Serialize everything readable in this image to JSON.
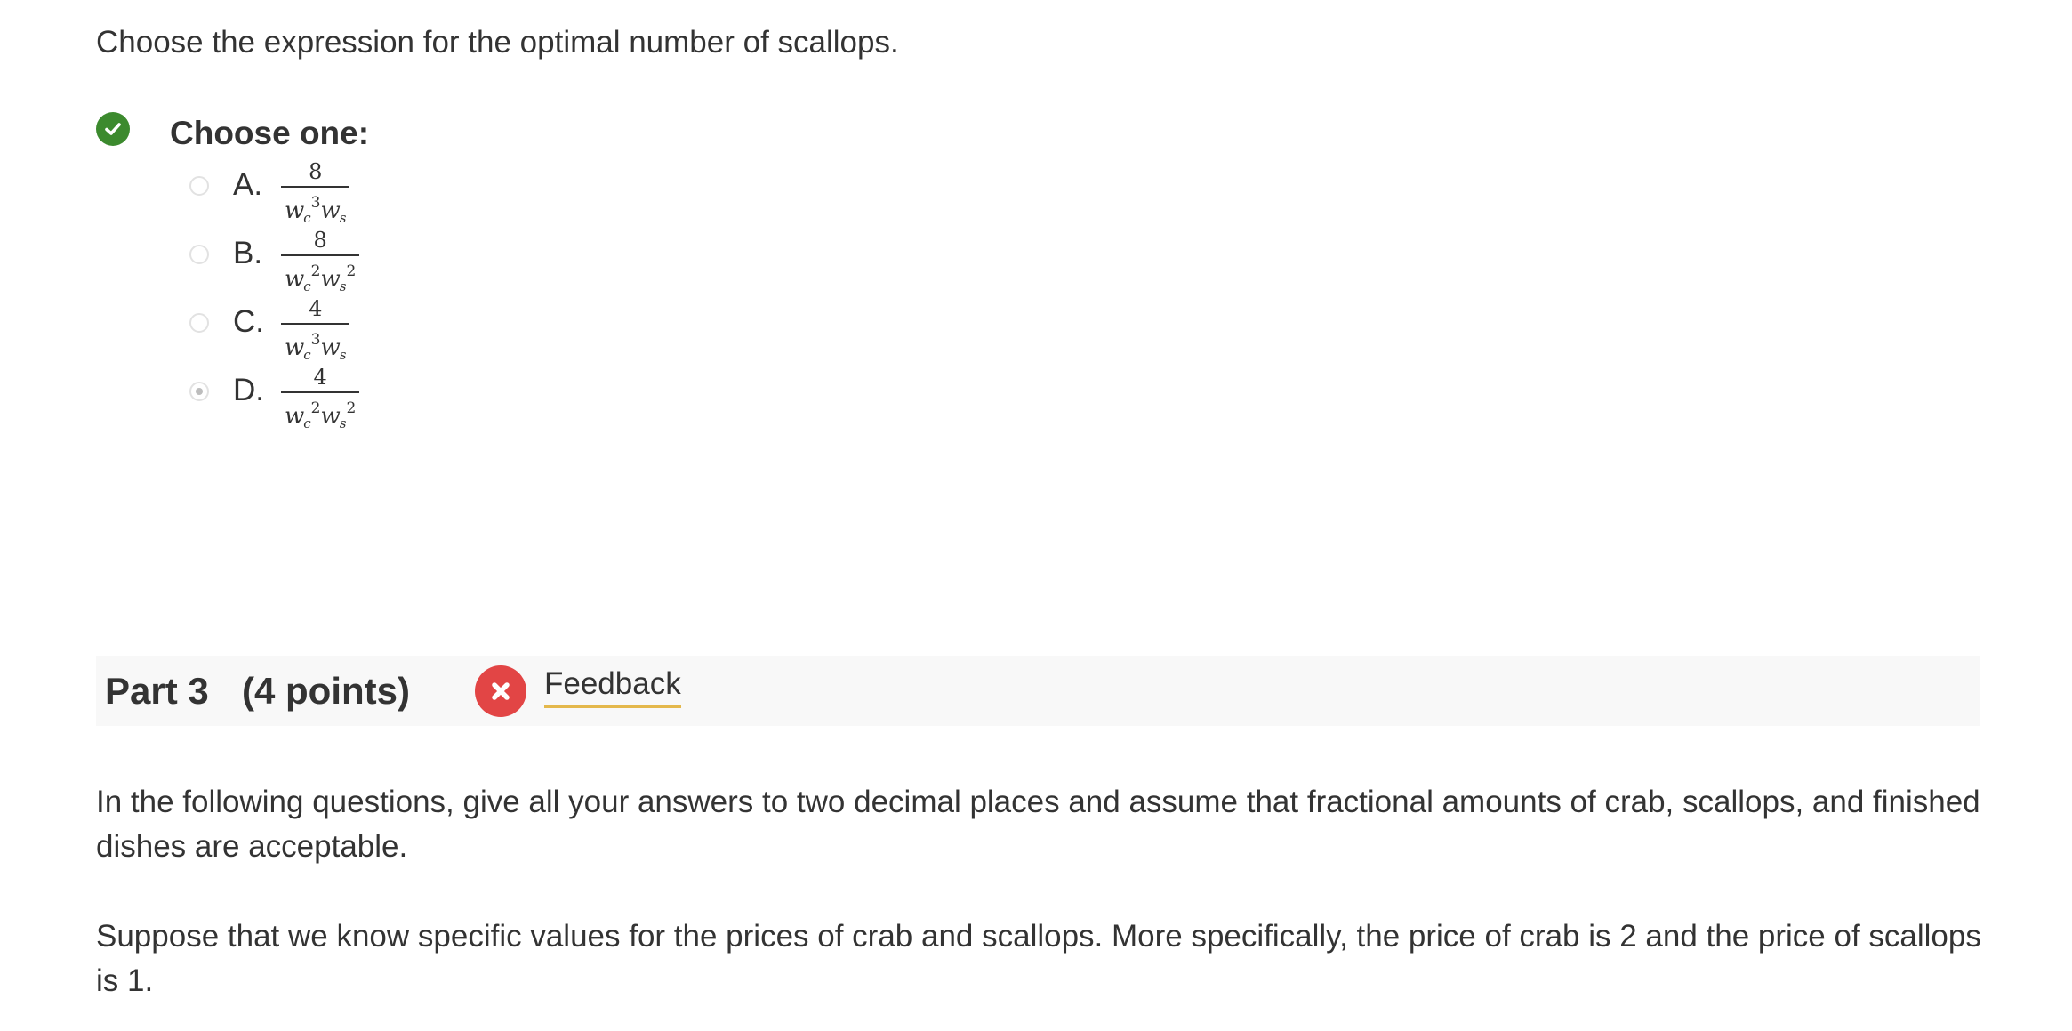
{
  "question": {
    "text": "Choose the expression for the optimal number of scallops."
  },
  "choice_group": {
    "label": "Choose one:",
    "status": "correct",
    "options": [
      {
        "letter": "A.",
        "numerator": "8",
        "den_var1": "w",
        "den_sub1": "c",
        "den_sup1": "3",
        "den_var2": "w",
        "den_sub2": "s",
        "den_sup2": "",
        "selected": false
      },
      {
        "letter": "B.",
        "numerator": "8",
        "den_var1": "w",
        "den_sub1": "c",
        "den_sup1": "2",
        "den_var2": "w",
        "den_sub2": "s",
        "den_sup2": "2",
        "selected": false
      },
      {
        "letter": "C.",
        "numerator": "4",
        "den_var1": "w",
        "den_sub1": "c",
        "den_sup1": "3",
        "den_var2": "w",
        "den_sub2": "s",
        "den_sup2": "",
        "selected": false
      },
      {
        "letter": "D.",
        "numerator": "4",
        "den_var1": "w",
        "den_sub1": "c",
        "den_sup1": "2",
        "den_var2": "w",
        "den_sub2": "s",
        "den_sup2": "2",
        "selected": true
      }
    ]
  },
  "part": {
    "title": "Part 3",
    "points": "(4 points)",
    "status": "incorrect",
    "feedback_label": "Feedback"
  },
  "paragraphs": [
    "In the following questions, give all your answers to two decimal places and assume that fractional amounts of crab, scallops, and finished dishes are acceptable.",
    "Suppose that we know specific values for the prices of crab and scallops. More specifically, the price of crab is 2 and the price of scallops is 1."
  ],
  "colors": {
    "correct": "#3c8a2e",
    "incorrect": "#e24545",
    "feedback_underline": "#e4b84c",
    "part_bar_bg": "#f8f8f8",
    "text": "#333333"
  },
  "icons": {
    "correct": "check-circle-icon",
    "incorrect": "x-circle-icon"
  }
}
